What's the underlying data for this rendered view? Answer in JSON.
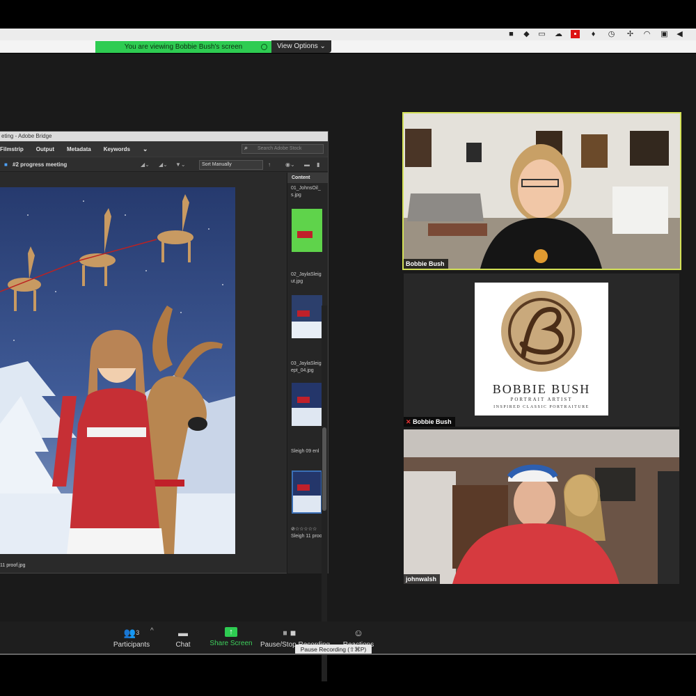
{
  "zoom": {
    "share_banner": "You are viewing Bobbie Bush's screen",
    "view_options": "View Options ⌄"
  },
  "bridge": {
    "window_title": "eting - Adobe Bridge",
    "tabs": [
      "Filmstrip",
      "Output",
      "Metadata",
      "Keywords"
    ],
    "search_placeholder": "Search Adobe Stock",
    "folder_path": "#2 progress meeting",
    "sort": "Sort Manually",
    "content_header": "Content",
    "items": [
      {
        "label": "01_JohnsOil_ s.jpg"
      },
      {
        "label": "02_JaylaSleig ut.jpg"
      },
      {
        "label": "03_JaylaSleig ept_04.jpg"
      },
      {
        "label": "Sleigh 09 enl"
      },
      {
        "label": "Sleigh 11 proo"
      }
    ],
    "preview_caption": "11 proof.jpg",
    "stars": "⊘☆☆☆☆☆"
  },
  "participants_tiles": [
    {
      "name": "Bobbie Bush"
    },
    {
      "name": "Bobbie Bush"
    },
    {
      "name": "johnwalsh"
    }
  ],
  "logo": {
    "name": "BOBBIE BUSH",
    "subtitle": "PORTRAIT ARTIST",
    "tagline": "INSPIRED CLASSIC PORTRAITURE"
  },
  "toolbar": {
    "participants_label": "Participants",
    "participants_count": "3",
    "chat_label": "Chat",
    "share_label": "Share Screen",
    "record_label": "Pause/Stop Recording",
    "reactions_label": "Reactions",
    "tooltip": "Pause Recording (⇧⌘P)"
  },
  "colors": {
    "share_green": "#2ecc52",
    "active_speaker": "#d4e157"
  }
}
